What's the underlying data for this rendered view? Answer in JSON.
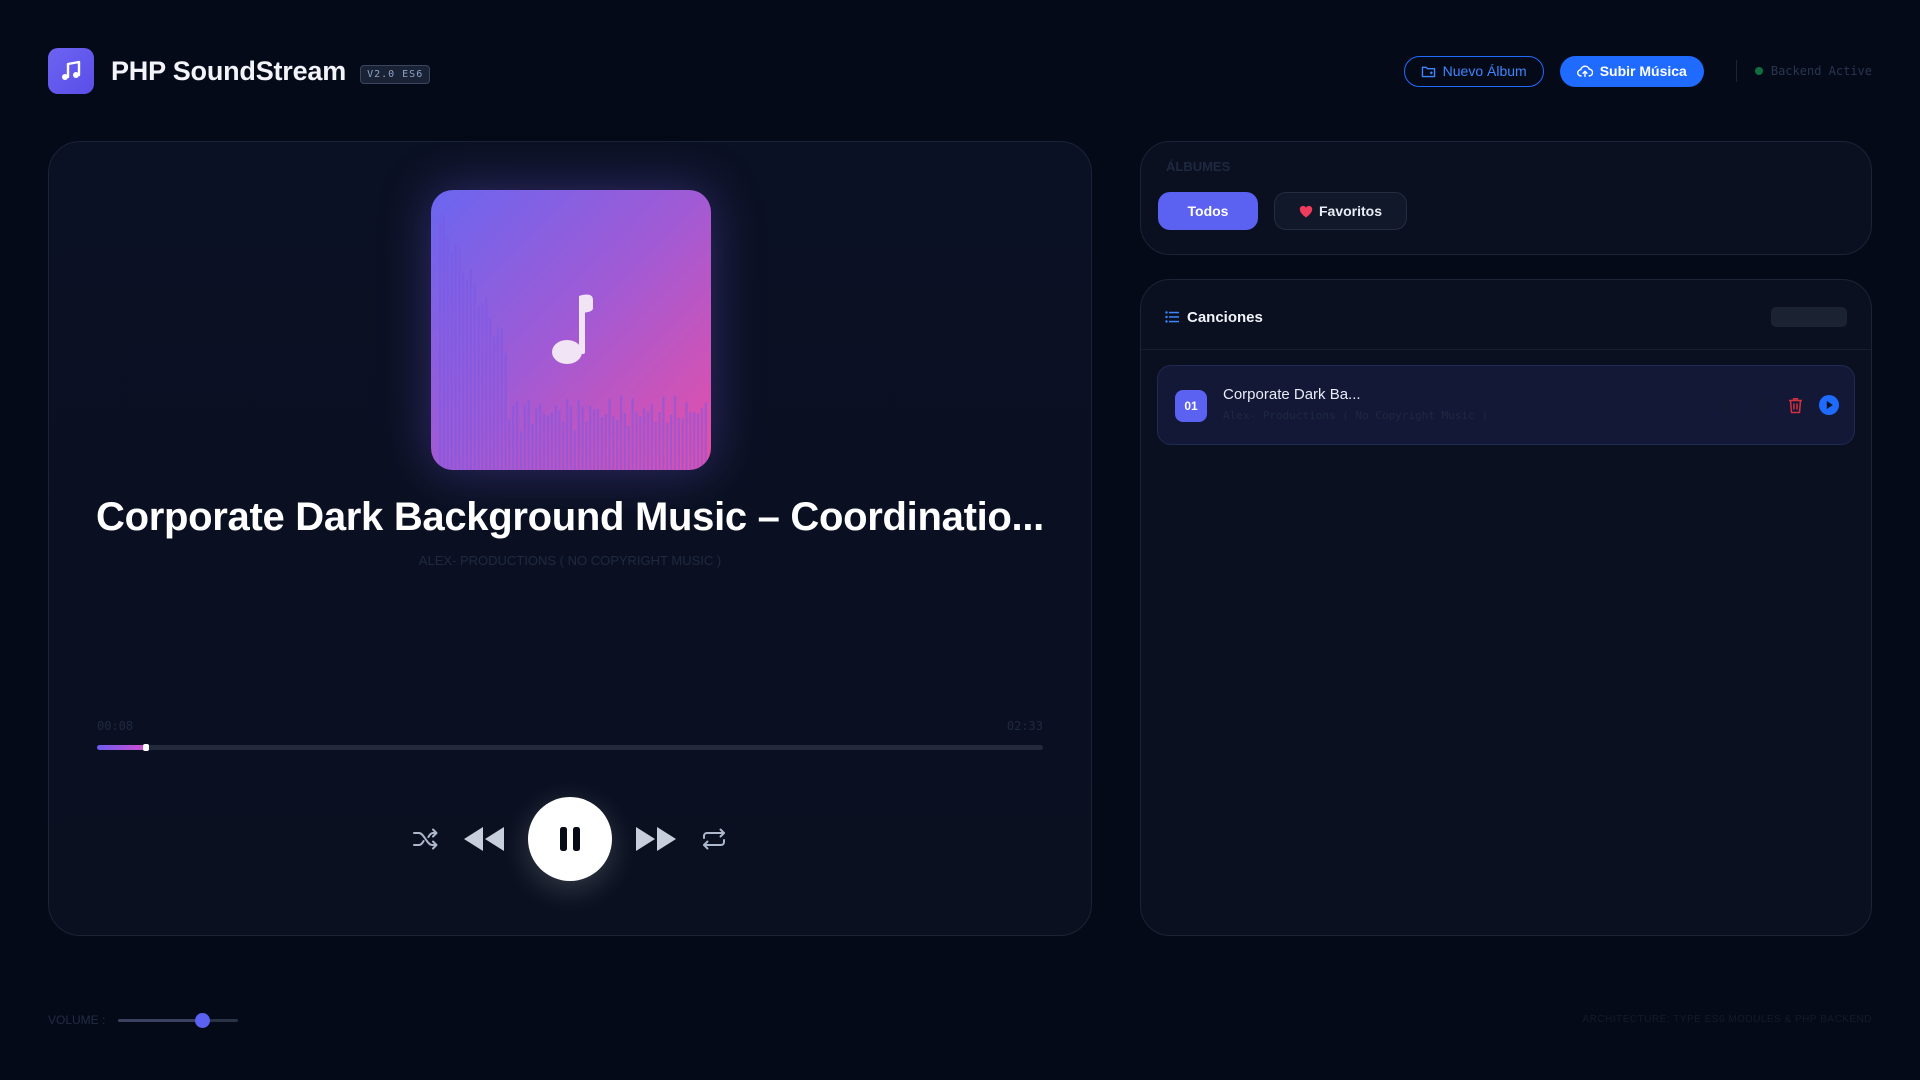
{
  "header": {
    "app_title": "PHP SoundStream",
    "version_badge": "V2.0 ES6",
    "new_album_label": "Nuevo Álbum",
    "upload_label": "Subir Música",
    "backend_status": "Backend Active",
    "status_color": "#0f6f3e"
  },
  "player": {
    "track_title": "Corporate Dark Background Music – Coordinatio...",
    "track_artist": "ALEX- PRODUCTIONS ( NO COPYRIGHT MUSIC )",
    "time_current": "00:08",
    "time_total": "02:33",
    "progress_percent": 5.2,
    "state": "playing"
  },
  "albums": {
    "heading": "ÁLBUMES",
    "all_label": "Todos",
    "favorites_label": "Favoritos"
  },
  "songs": {
    "heading": "Canciones",
    "items": [
      {
        "number": "01",
        "title": "Corporate Dark Ba...",
        "artist": "Alex- Productions ( No Copyright Music )"
      }
    ]
  },
  "footer": {
    "volume_label": "VOLUME :",
    "volume_percent": 70,
    "credit": "ARCHITECTURE: TYPE ES6 MODULES & PHP BACKEND"
  },
  "colors": {
    "accent": "#5b61f0",
    "primary_blue": "#1f6bff",
    "background": "#050a18",
    "favorite_heart": "#ef3b5c",
    "delete_icon": "#d6303f"
  },
  "icons": {
    "logo": "music-note-icon",
    "new_album": "folder-icon",
    "upload": "cloud-upload-icon",
    "favorites": "heart-icon",
    "songs_list": "list-icon",
    "shuffle": "shuffle-icon",
    "previous": "rewind-icon",
    "play_pause": "pause-icon",
    "next": "fast-forward-icon",
    "repeat": "repeat-icon",
    "delete": "trash-icon",
    "play_row": "play-icon"
  }
}
